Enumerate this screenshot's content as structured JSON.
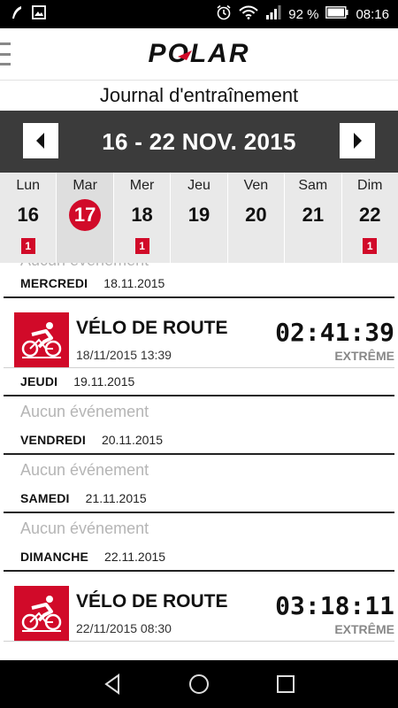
{
  "status_bar": {
    "battery_percent": "92 %",
    "time": "08:16",
    "icons": [
      "feather-icon",
      "image-icon",
      "alarm-icon",
      "wifi-icon",
      "signal-icon",
      "battery-icon"
    ]
  },
  "app_bar": {
    "menu_icon": "menu-icon",
    "logo_text": "POLAR"
  },
  "page": {
    "title": "Journal d'entraînement"
  },
  "week": {
    "label": "16 - 22 NOV. 2015",
    "prev_icon": "chevron-left-icon",
    "next_icon": "chevron-right-icon"
  },
  "days": [
    {
      "name": "Lun",
      "num": "16",
      "badge": "1",
      "today": false
    },
    {
      "name": "Mar",
      "num": "17",
      "badge": "",
      "today": true
    },
    {
      "name": "Mer",
      "num": "18",
      "badge": "1",
      "today": false
    },
    {
      "name": "Jeu",
      "num": "19",
      "badge": "",
      "today": false
    },
    {
      "name": "Ven",
      "num": "20",
      "badge": "",
      "today": false
    },
    {
      "name": "Sam",
      "num": "21",
      "badge": "",
      "today": false
    },
    {
      "name": "Dim",
      "num": "22",
      "badge": "1",
      "today": false
    }
  ],
  "list": {
    "clipped_empty": "Aucun événement",
    "sections": [
      {
        "day": "MERCREDI",
        "date": "18.11.2015",
        "session": {
          "icon": "road-bike-icon",
          "title": "VÉLO DE ROUTE",
          "datetime": "18/11/2015 13:39",
          "duration": "02:41:39",
          "intensity": "EXTRÊME"
        }
      },
      {
        "day": "JEUDI",
        "date": "19.11.2015",
        "empty": "Aucun événement"
      },
      {
        "day": "VENDREDI",
        "date": "20.11.2015",
        "empty": "Aucun événement"
      },
      {
        "day": "SAMEDI",
        "date": "21.11.2015",
        "empty": "Aucun événement"
      },
      {
        "day": "DIMANCHE",
        "date": "22.11.2015",
        "session": {
          "icon": "road-bike-icon",
          "title": "VÉLO DE ROUTE",
          "datetime": "22/11/2015 08:30",
          "duration": "03:18:11",
          "intensity": "EXTRÊME"
        }
      }
    ]
  },
  "nav_bar": {
    "icons": [
      "back-icon",
      "home-icon",
      "recents-icon"
    ]
  },
  "colors": {
    "accent": "#d10a29",
    "week_bar": "#3b3b3b",
    "day_strip": "#e9e9e9"
  }
}
